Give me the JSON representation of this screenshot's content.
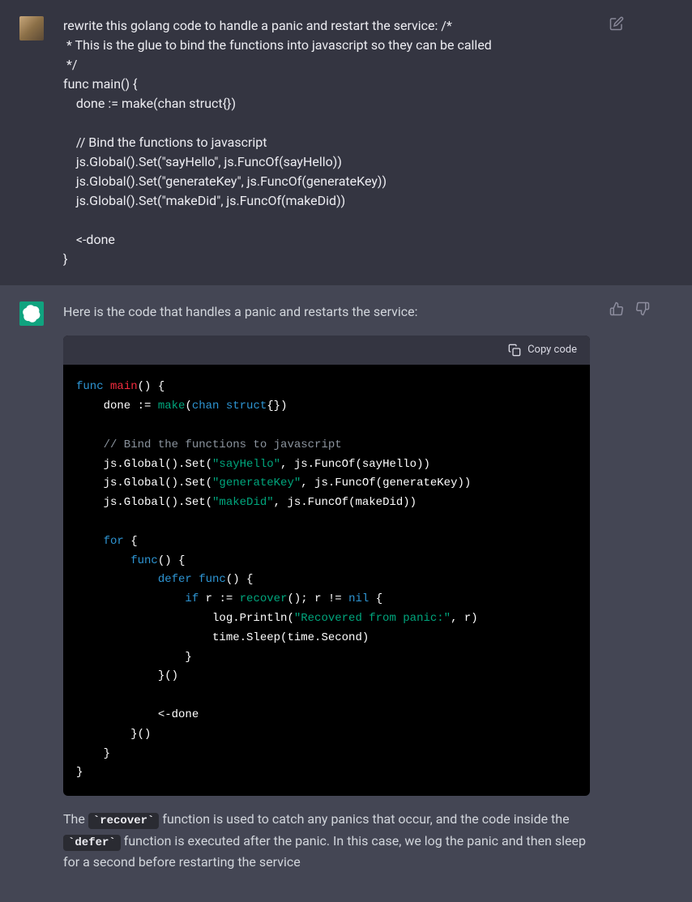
{
  "user_message": {
    "text": "rewrite this golang code to handle a panic and restart the service: /*\n * This is the glue to bind the functions into javascript so they can be called\n */\nfunc main() {\n    done := make(chan struct{})\n\n    // Bind the functions to javascript\n    js.Global().Set(\"sayHello\", js.FuncOf(sayHello))\n    js.Global().Set(\"generateKey\", js.FuncOf(generateKey))\n    js.Global().Set(\"makeDid\", js.FuncOf(makeDid))\n\n    <-done\n}"
  },
  "assistant_message": {
    "intro": "Here is the code that handles a panic and restarts the service:",
    "code_header": {
      "copy_label": "Copy code"
    },
    "code": {
      "line1_kw1": "func",
      "line1_fn": "main",
      "line1_rest": "() {",
      "line2_indent": "    done := ",
      "line2_builtin": "make",
      "line2_paren": "(",
      "line2_kw": "chan",
      "line2_type": " struct",
      "line2_rest": "{})",
      "line4_cmt": "    // Bind the functions to javascript",
      "line5a": "    js.Global().Set(",
      "line5_str": "\"sayHello\"",
      "line5b": ", js.FuncOf(sayHello))",
      "line6a": "    js.Global().Set(",
      "line6_str": "\"generateKey\"",
      "line6b": ", js.FuncOf(generateKey))",
      "line7a": "    js.Global().Set(",
      "line7_str": "\"makeDid\"",
      "line7b": ", js.FuncOf(makeDid))",
      "line9_kw": "    for",
      "line9_rest": " {",
      "line10_kw": "        func",
      "line10_rest": "() {",
      "line11_kw1": "            defer",
      "line11_kw2": " func",
      "line11_rest": "() {",
      "line12_kw": "                if",
      "line12_a": " r := ",
      "line12_builtin": "recover",
      "line12_b": "(); r != ",
      "line12_nil": "nil",
      "line12_c": " {",
      "line13_a": "                    log.Println(",
      "line13_str": "\"Recovered from panic:\"",
      "line13_b": ", r)",
      "line14": "                    time.Sleep(time.Second)",
      "line15": "                }",
      "line16": "            }()",
      "line18": "            <-done",
      "line19": "        }()",
      "line20": "    }",
      "line21": "}"
    },
    "outro_parts": {
      "p1": "The ",
      "code1": "`recover`",
      "p2": " function is used to catch any panics that occur, and the code inside the ",
      "code2": "`defer`",
      "p3": " function is executed after the panic. In this case, we log the panic and then sleep for a second before restarting the service"
    }
  }
}
